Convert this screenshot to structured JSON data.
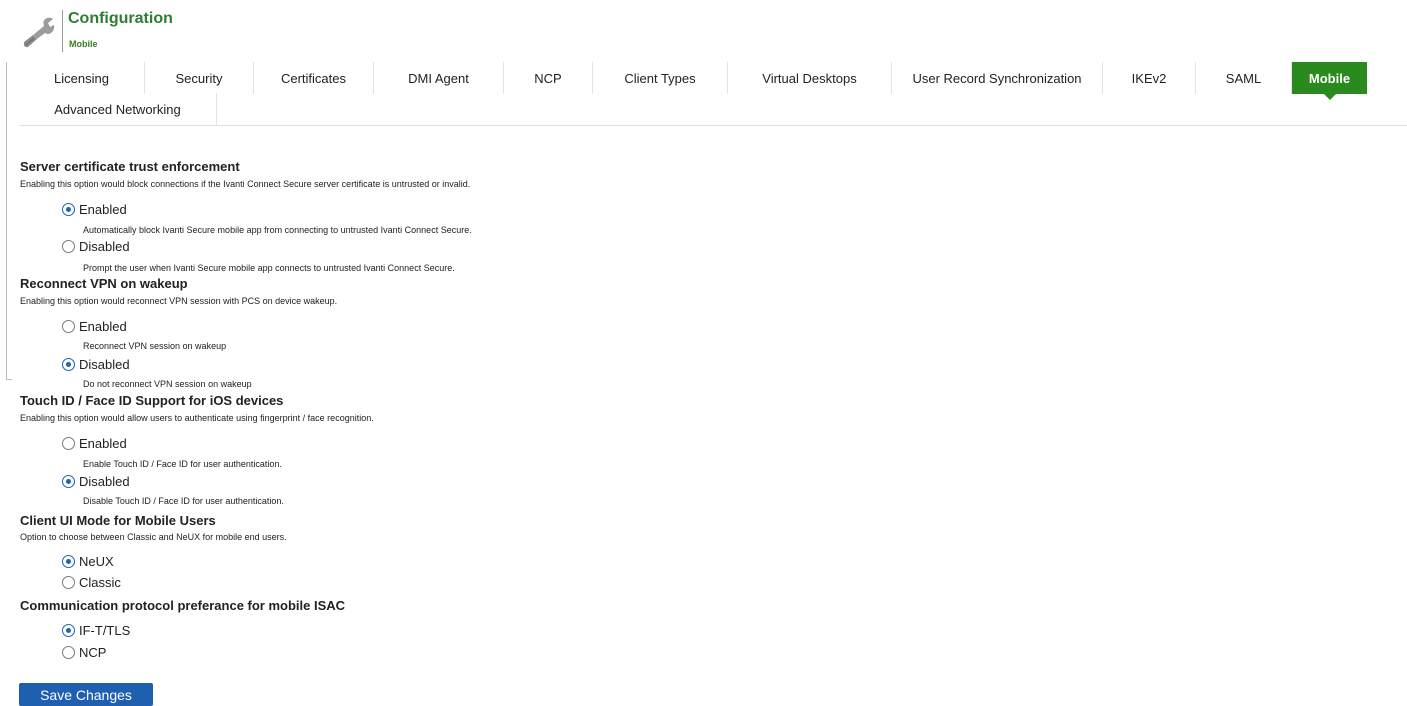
{
  "header": {
    "title": "Configuration",
    "subtitle": "Mobile",
    "icon": "wrench-icon"
  },
  "tabs": [
    {
      "label": "Licensing",
      "active": false
    },
    {
      "label": "Security",
      "active": false
    },
    {
      "label": "Certificates",
      "active": false
    },
    {
      "label": "DMI Agent",
      "active": false
    },
    {
      "label": "NCP",
      "active": false
    },
    {
      "label": "Client Types",
      "active": false
    },
    {
      "label": "Virtual Desktops",
      "active": false
    },
    {
      "label": "User Record Synchronization",
      "active": false
    },
    {
      "label": "IKEv2",
      "active": false
    },
    {
      "label": "SAML",
      "active": false
    },
    {
      "label": "Mobile",
      "active": true
    },
    {
      "label": "Advanced Networking",
      "active": false
    }
  ],
  "sections": [
    {
      "title": "Server certificate trust enforcement",
      "description": "Enabling this option would block connections if the Ivanti Connect Secure server certificate is untrusted or invalid.",
      "options": [
        {
          "label": "Enabled",
          "checked": true,
          "description": "Automatically block Ivanti Secure mobile app from connecting to untrusted Ivanti Connect Secure."
        },
        {
          "label": "Disabled",
          "checked": false,
          "description": "Prompt the user when Ivanti Secure mobile app connects to untrusted Ivanti Connect Secure."
        }
      ]
    },
    {
      "title": "Reconnect VPN on wakeup",
      "description": "Enabling this option would reconnect VPN session with PCS on device wakeup.",
      "options": [
        {
          "label": "Enabled",
          "checked": false,
          "description": "Reconnect VPN session on wakeup"
        },
        {
          "label": "Disabled",
          "checked": true,
          "description": "Do not reconnect VPN session on wakeup"
        }
      ]
    },
    {
      "title": "Touch ID / Face ID Support for iOS devices",
      "description": "Enabling this option would allow users to authenticate using fingerprint / face recognition.",
      "options": [
        {
          "label": "Enabled",
          "checked": false,
          "description": "Enable Touch ID / Face ID for user authentication."
        },
        {
          "label": "Disabled",
          "checked": true,
          "description": "Disable Touch ID / Face ID for user authentication."
        }
      ]
    },
    {
      "title": "Client UI Mode for Mobile Users",
      "description": "Option to choose between Classic and NeUX for mobile end users.",
      "options": [
        {
          "label": "NeUX",
          "checked": true
        },
        {
          "label": "Classic",
          "checked": false
        }
      ]
    },
    {
      "title": "Communication protocol preferance for mobile ISAC",
      "options": [
        {
          "label": "IF-T/TLS",
          "checked": true
        },
        {
          "label": "NCP",
          "checked": false
        }
      ]
    }
  ],
  "save_button": {
    "label": "Save Changes"
  },
  "colors": {
    "brand_green": "#2b8a1d",
    "title_green": "#2e7d32",
    "radio_blue": "#1e63b4",
    "button_blue": "#1f5fb0"
  }
}
